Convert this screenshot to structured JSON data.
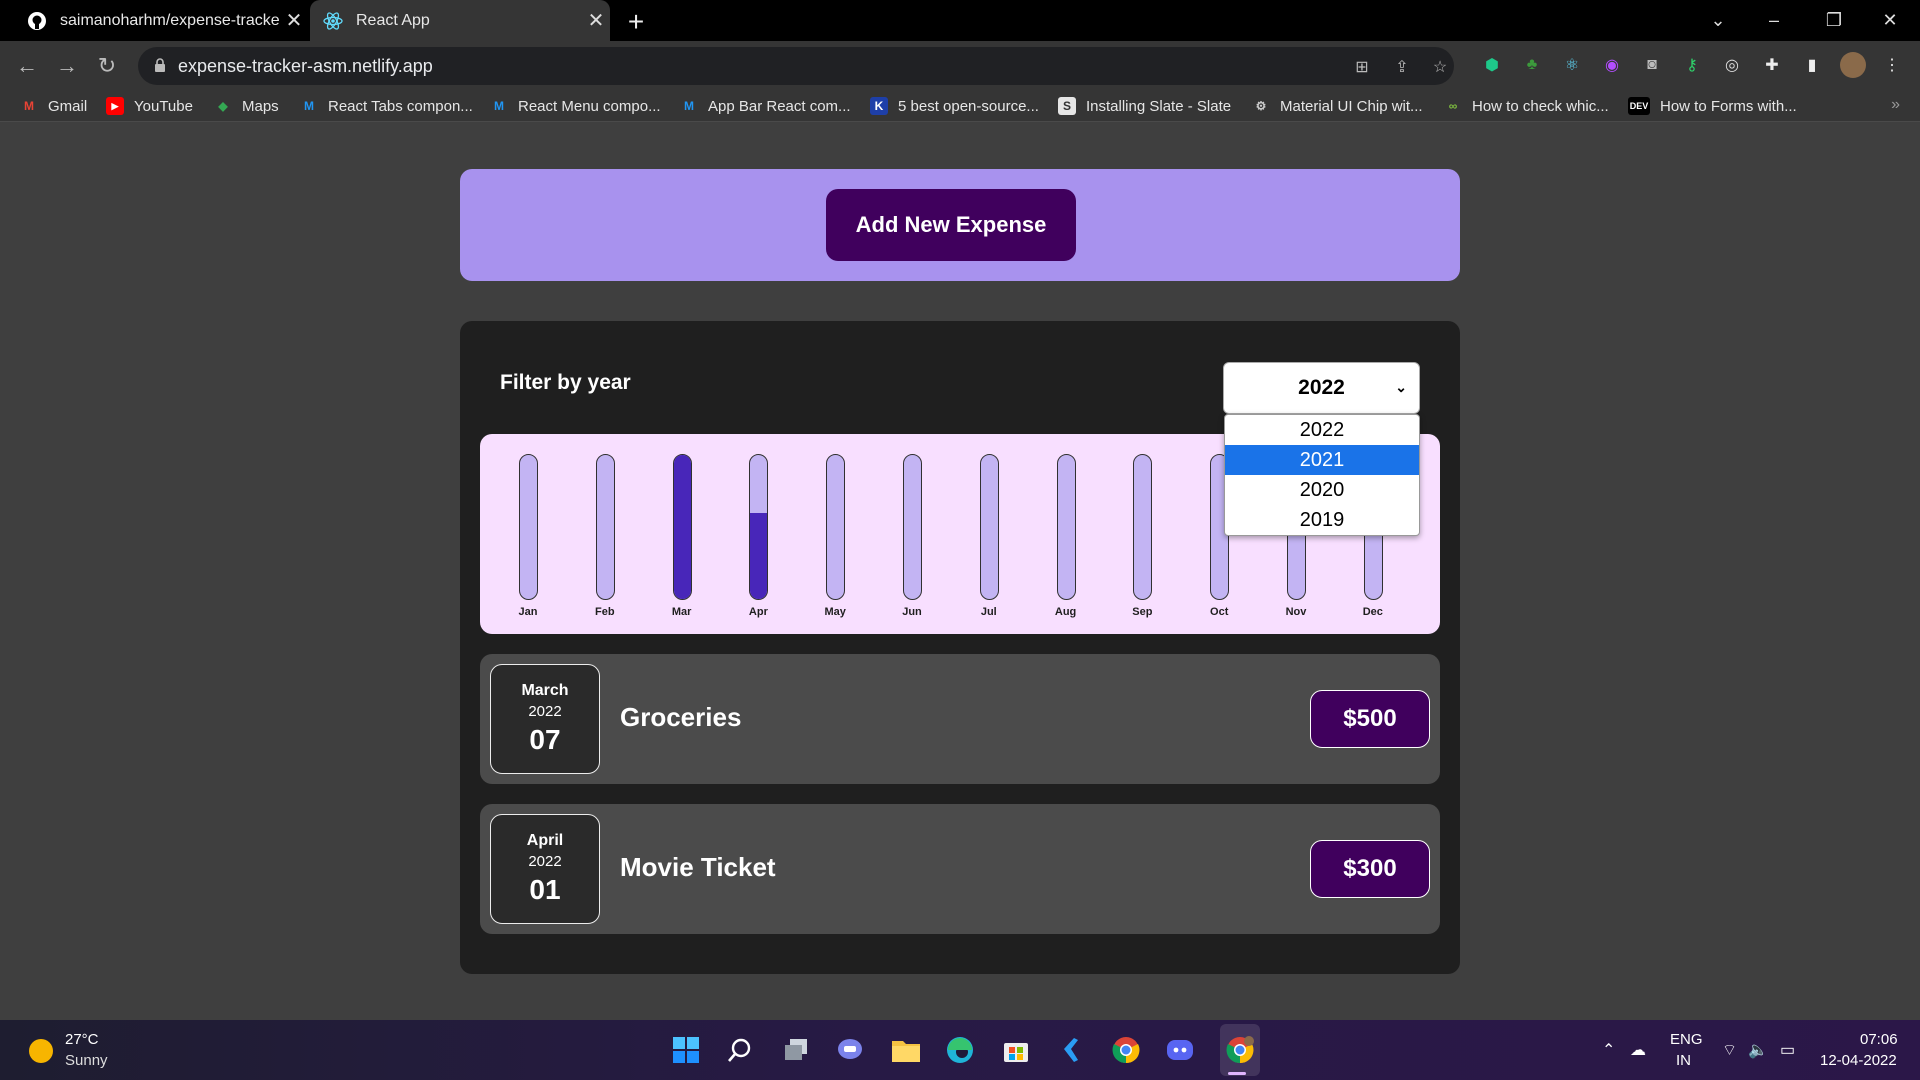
{
  "browser": {
    "tabs": [
      {
        "title": "saimanoharhm/expense-tracker:",
        "favicon": "github-icon",
        "active": false
      },
      {
        "title": "React App",
        "favicon": "react-icon",
        "active": true
      }
    ],
    "url": "expense-tracker-asm.netlify.app",
    "bookmarks": [
      {
        "label": "Gmail",
        "icon": "gmail-icon"
      },
      {
        "label": "YouTube",
        "icon": "youtube-icon"
      },
      {
        "label": "Maps",
        "icon": "maps-icon"
      },
      {
        "label": "React Tabs compon...",
        "icon": "mui-icon"
      },
      {
        "label": "React Menu compo...",
        "icon": "mui-icon"
      },
      {
        "label": "App Bar React com...",
        "icon": "mui-icon"
      },
      {
        "label": "5 best open-source...",
        "icon": "k-icon"
      },
      {
        "label": "Installing Slate - Slate",
        "icon": "s-icon"
      },
      {
        "label": "Material UI Chip wit...",
        "icon": "chip-icon"
      },
      {
        "label": "How to check whic...",
        "icon": "link-icon"
      },
      {
        "label": "How to Forms with...",
        "icon": "dev-icon"
      }
    ]
  },
  "new_expense": {
    "button_label": "Add New Expense"
  },
  "filter": {
    "label": "Filter by year",
    "selected_year": "2022",
    "options": [
      "2022",
      "2021",
      "2020",
      "2019"
    ],
    "highlighted_option": "2021"
  },
  "chart_data": {
    "type": "bar",
    "categories": [
      "Jan",
      "Feb",
      "Mar",
      "Apr",
      "May",
      "Jun",
      "Jul",
      "Aug",
      "Sep",
      "Oct",
      "Nov",
      "Dec"
    ],
    "values": [
      0,
      0,
      500,
      300,
      0,
      0,
      0,
      0,
      0,
      0,
      0,
      0
    ],
    "ylim": [
      0,
      500
    ]
  },
  "expenses": [
    {
      "month": "March",
      "year": "2022",
      "day": "07",
      "title": "Groceries",
      "amount": "$500"
    },
    {
      "month": "April",
      "year": "2022",
      "day": "01",
      "title": "Movie Ticket",
      "amount": "$300"
    }
  ],
  "taskbar": {
    "weather_temp": "27°C",
    "weather_condition": "Sunny",
    "lang_line1": "ENG",
    "lang_line2": "IN",
    "time": "07:06",
    "date": "12-04-2022"
  }
}
